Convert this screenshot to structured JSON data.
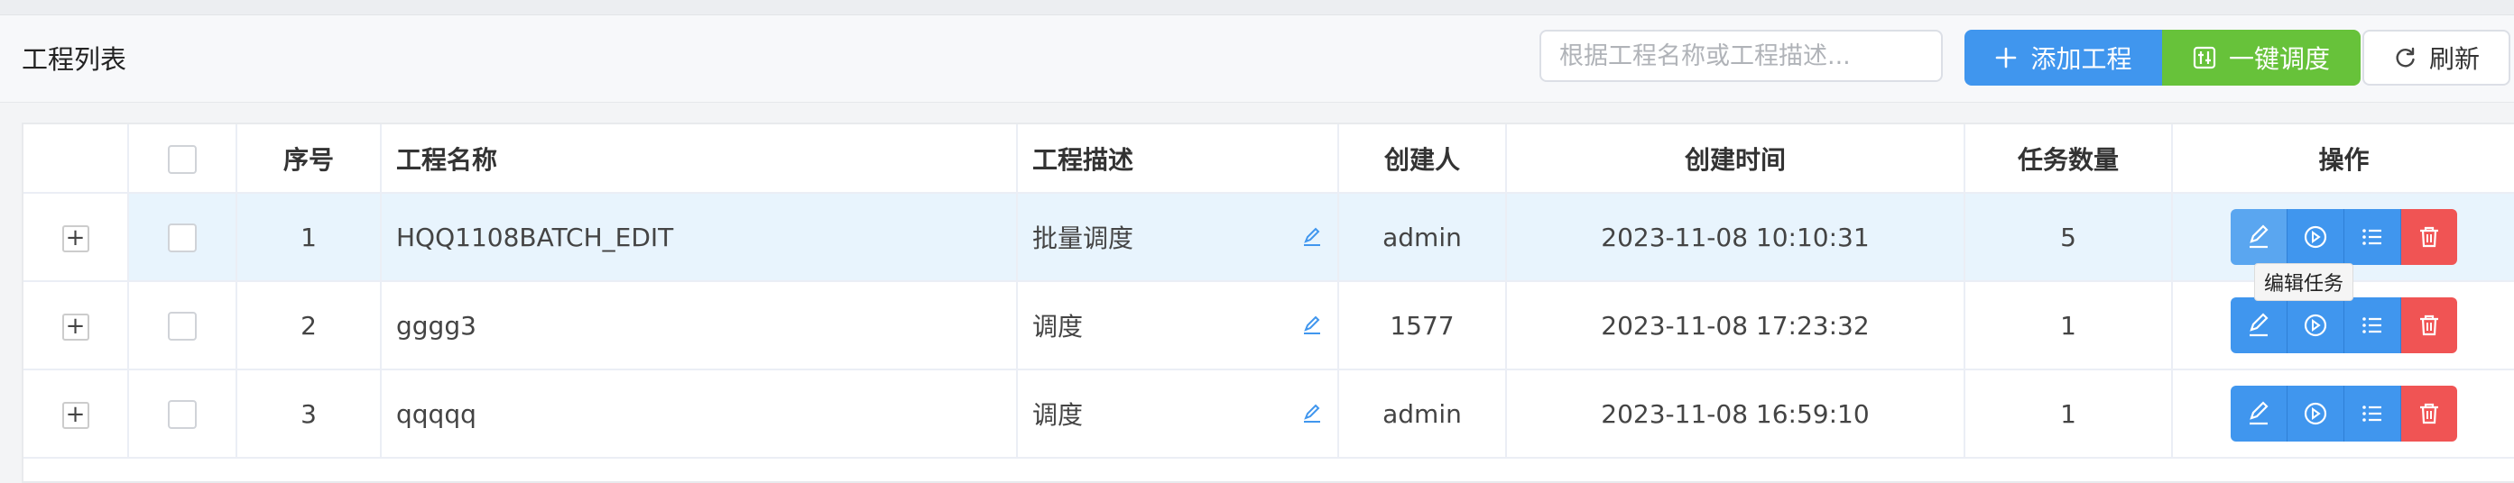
{
  "header": {
    "title": "工程列表",
    "search_placeholder": "根据工程名称或工程描述...",
    "add_label": "添加工程",
    "dispatch_label": "一键调度",
    "refresh_label": "刷新"
  },
  "table": {
    "columns": [
      "序号",
      "工程名称",
      "工程描述",
      "创建人",
      "创建时间",
      "任务数量",
      "操作"
    ],
    "rows": [
      {
        "index": "1",
        "name": "HQQ1108BATCH_EDIT",
        "desc": "批量调度",
        "creator": "admin",
        "created": "2023-11-08 10:10:31",
        "tasks": "5"
      },
      {
        "index": "2",
        "name": "gggg3",
        "desc": "调度",
        "creator": "1577",
        "created": "2023-11-08 17:23:32",
        "tasks": "1"
      },
      {
        "index": "3",
        "name": "qqqqq",
        "desc": "调度",
        "creator": "admin",
        "created": "2023-11-08 16:59:10",
        "tasks": "1"
      }
    ]
  },
  "tooltip": "编辑任务",
  "colors": {
    "primary": "#4096ee",
    "success": "#67c23a",
    "danger": "#f05454",
    "row_highlight": "#e8f4fd"
  }
}
